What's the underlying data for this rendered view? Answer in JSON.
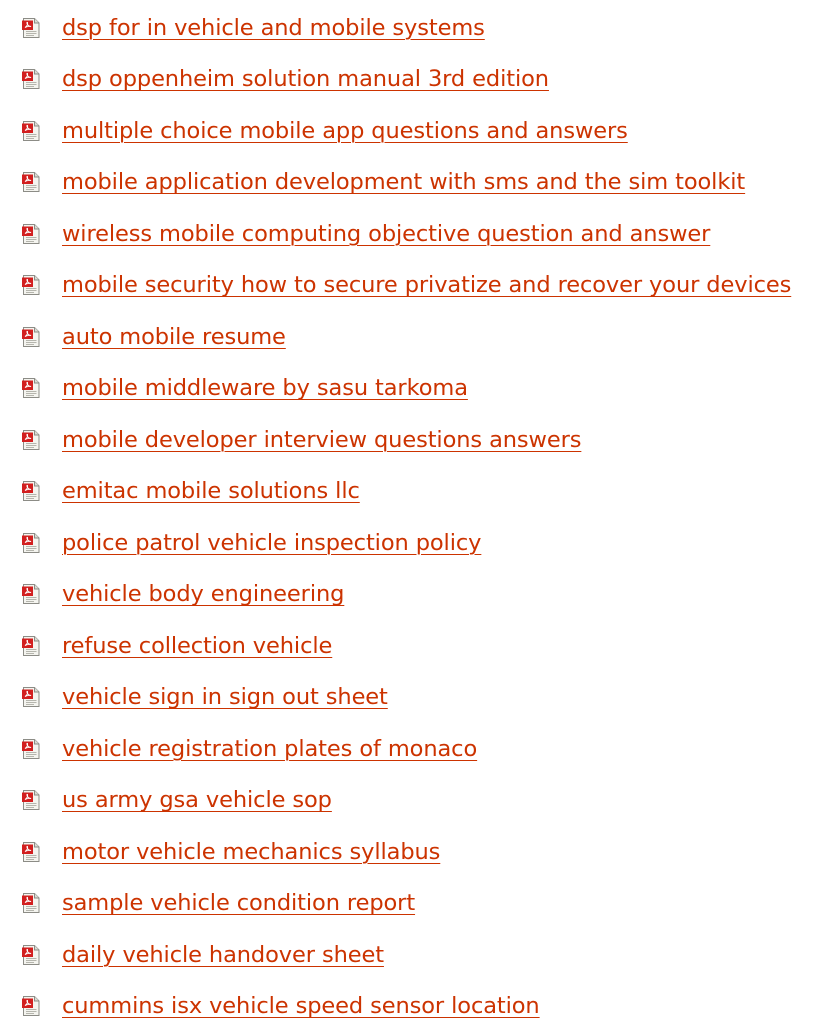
{
  "link_color": "#cc3300",
  "icon": "pdf-document-icon",
  "items": [
    {
      "label": "dsp for in vehicle and mobile systems"
    },
    {
      "label": "dsp oppenheim solution manual 3rd edition"
    },
    {
      "label": "multiple choice mobile app questions and answers"
    },
    {
      "label": "mobile application development with sms and the sim toolkit"
    },
    {
      "label": "wireless mobile computing objective question and answer"
    },
    {
      "label": "mobile security how to secure privatize and recover your devices"
    },
    {
      "label": "auto mobile resume"
    },
    {
      "label": "mobile middleware by sasu tarkoma"
    },
    {
      "label": "mobile developer interview questions answers"
    },
    {
      "label": "emitac mobile solutions llc"
    },
    {
      "label": "police patrol vehicle inspection policy"
    },
    {
      "label": "vehicle body engineering"
    },
    {
      "label": "refuse collection vehicle"
    },
    {
      "label": "vehicle sign in sign out sheet"
    },
    {
      "label": "vehicle registration plates of monaco"
    },
    {
      "label": "us army gsa vehicle sop"
    },
    {
      "label": "motor vehicle mechanics syllabus"
    },
    {
      "label": "sample vehicle condition report"
    },
    {
      "label": "daily vehicle handover sheet"
    },
    {
      "label": "cummins isx vehicle speed sensor location"
    }
  ]
}
